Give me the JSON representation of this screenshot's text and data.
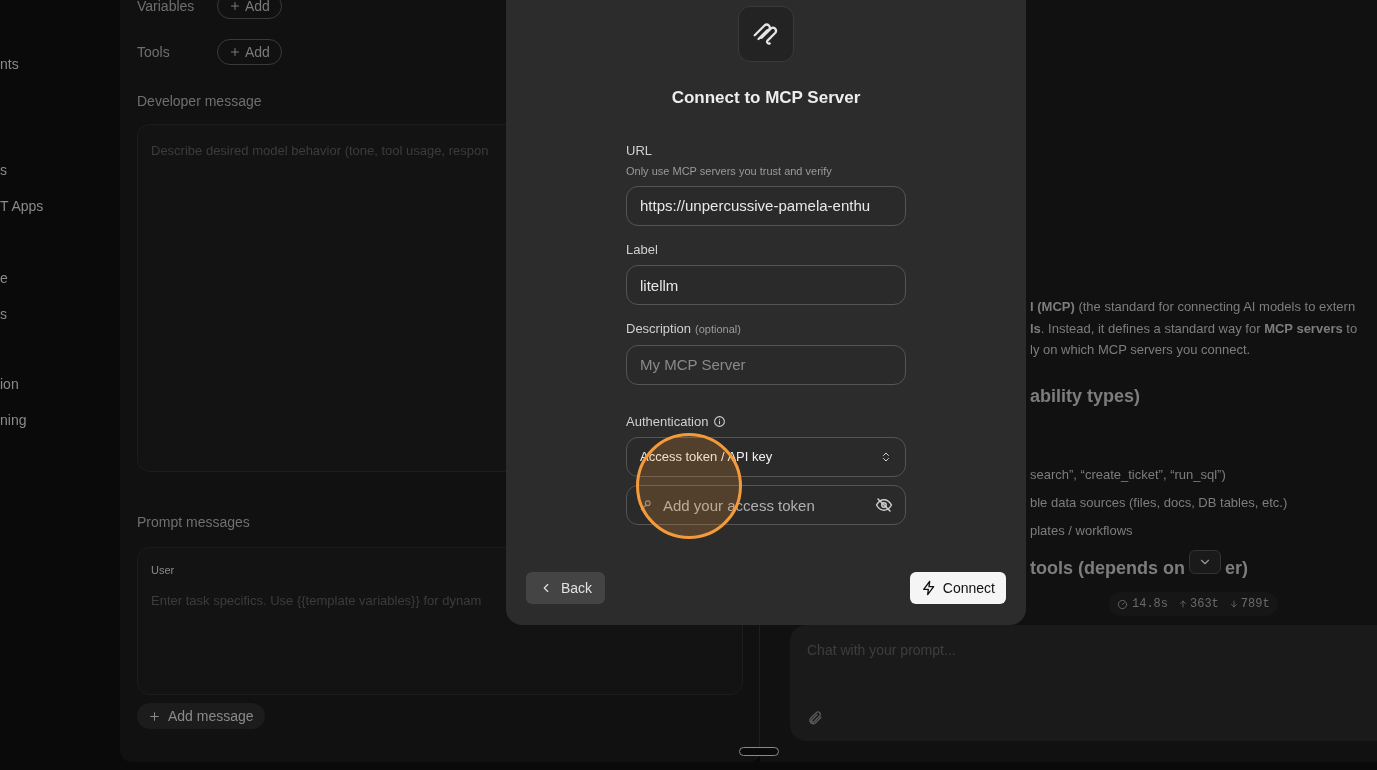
{
  "sidebar": {
    "items": [
      {
        "label": "nts"
      },
      {
        "label": "s"
      },
      {
        "label": "T Apps"
      },
      {
        "label": "e"
      },
      {
        "label": "s"
      },
      {
        "label": "ion"
      },
      {
        "label": "ning"
      }
    ]
  },
  "editor": {
    "rows": [
      {
        "label": "Variables",
        "button": "Add"
      },
      {
        "label": "Tools",
        "button": "Add"
      }
    ],
    "developer_message": {
      "label": "Developer message",
      "placeholder": "Describe desired model behavior (tone, tool usage, respon"
    },
    "prompt_messages": {
      "label": "Prompt messages",
      "messages": [
        {
          "role": "User",
          "placeholder": "Enter task specifics. Use {{template variables}} for dynam"
        }
      ],
      "add_button": "Add message"
    }
  },
  "response": {
    "lines": [
      "**l (MCP)** (the standard for connecting AI models to extern",
      "**ls**. Instead, it defines a standard way for **MCP servers** to",
      "ly on which MCP servers you connect."
    ],
    "heading_1": "ability types)",
    "list_items": [
      "search”, “create_ticket”, “run_sql”)",
      "ble data sources (files, docs, DB tables, etc.)",
      "plates / workflows"
    ],
    "heading_2": {
      "before": "tools (depends on",
      "after": "er)"
    },
    "stats": {
      "time": "14.8s",
      "tokens_up": "363t",
      "tokens_down": "789t"
    }
  },
  "chat": {
    "placeholder": "Chat with your prompt..."
  },
  "modal": {
    "title": "Connect to MCP Server",
    "url": {
      "label": "URL",
      "hint": "Only use MCP servers you trust and verify",
      "value": "https://unpercussive-pamela-enthu"
    },
    "label_field": {
      "label": "Label",
      "value": "litellm"
    },
    "description": {
      "label": "Description",
      "note": "(optional)",
      "placeholder": "My MCP Server"
    },
    "authentication": {
      "label": "Authentication",
      "value": "Access token / API key",
      "token_placeholder": "Add your access token"
    },
    "back_button": "Back",
    "connect_button": "Connect"
  }
}
